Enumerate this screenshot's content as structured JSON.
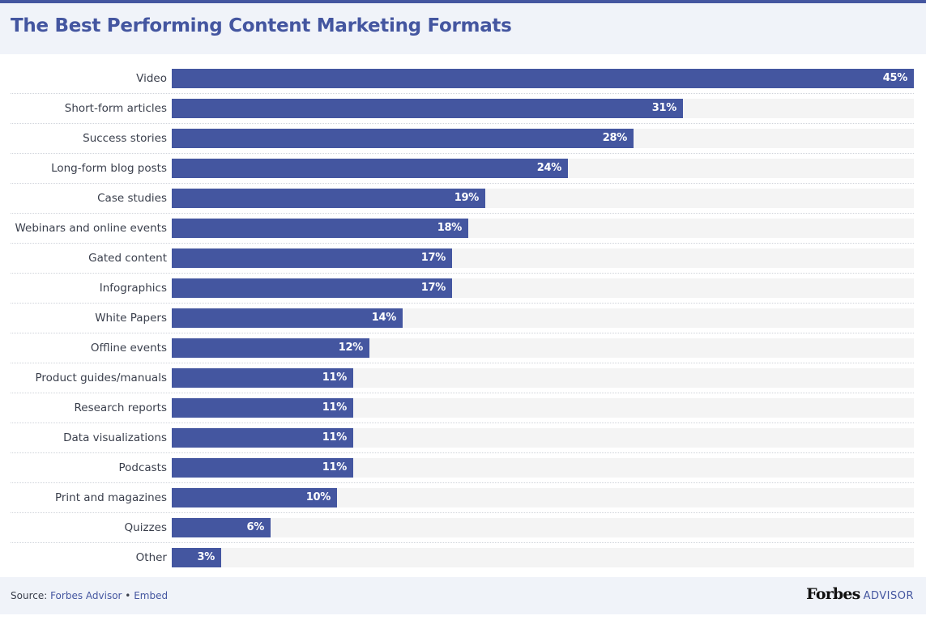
{
  "header": {
    "title": "The Best Performing Content Marketing Formats"
  },
  "colors": {
    "bar": "#4456a0",
    "track": "#f4f4f4",
    "header_bg": "#f0f3f9",
    "title": "#4456a0"
  },
  "chart_data": {
    "type": "bar",
    "orientation": "horizontal",
    "title": "The Best Performing Content Marketing Formats",
    "xlabel": "",
    "ylabel": "",
    "xlim": [
      0,
      45
    ],
    "grid": false,
    "legend": "none",
    "categories": [
      "Video",
      "Short-form articles",
      "Success stories",
      "Long-form blog posts",
      "Case studies",
      "Webinars and online events",
      "Gated content",
      "Infographics",
      "White Papers",
      "Offline events",
      "Product guides/manuals",
      "Research reports",
      "Data visualizations",
      "Podcasts",
      "Print and magazines",
      "Quizzes",
      "Other"
    ],
    "values": [
      45,
      31,
      28,
      24,
      19,
      18,
      17,
      17,
      14,
      12,
      11,
      11,
      11,
      11,
      10,
      6,
      3
    ],
    "value_labels": [
      "45%",
      "31%",
      "28%",
      "24%",
      "19%",
      "18%",
      "17%",
      "17%",
      "14%",
      "12%",
      "11%",
      "11%",
      "11%",
      "11%",
      "10%",
      "6%",
      "3%"
    ],
    "unit": "%"
  },
  "footer": {
    "source_prefix": "Source: ",
    "source_link": "Forbes Advisor",
    "separator": " • ",
    "embed_link": "Embed",
    "brand_name": "Forbes",
    "brand_suffix": "ADVISOR"
  }
}
